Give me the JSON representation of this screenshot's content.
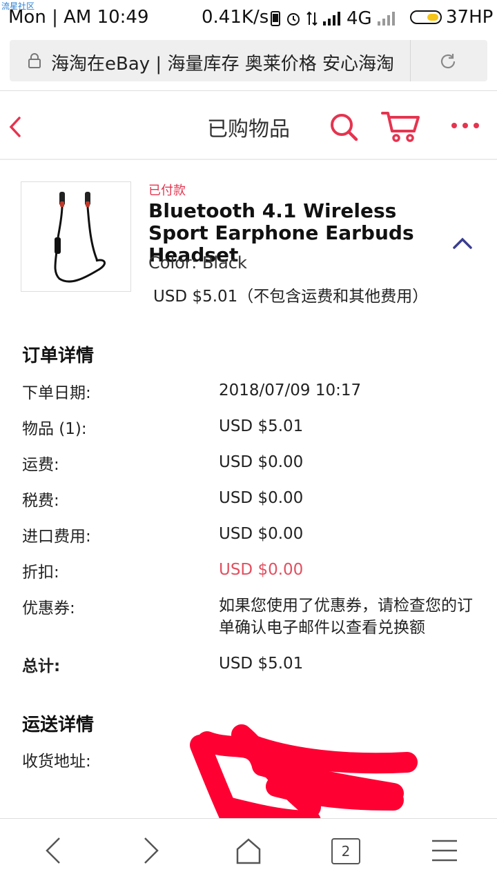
{
  "watermark": "流星社区",
  "status_bar": {
    "time": "Mon | AM  10:49",
    "net_speed": "0.41K/s",
    "network": "4G",
    "battery": "37HP"
  },
  "browser": {
    "url_text": "海淘在eBay | 海量库存 奥莱价格 安心海淘",
    "tab_count": "2"
  },
  "header": {
    "title": "已购物品"
  },
  "item": {
    "status": "已付款",
    "title": "Bluetooth 4.1 Wireless Sport Earphone Earbuds Headset",
    "color": "Color: Black",
    "price": "USD $5.01（不包含运费和其他费用）"
  },
  "order_details": {
    "heading": "订单详情",
    "rows": [
      {
        "label": "下单日期:",
        "value": "2018/07/09 10:17"
      },
      {
        "label": "物品 (1):",
        "value": "USD $5.01"
      },
      {
        "label": "运费:",
        "value": "USD $0.00"
      },
      {
        "label": "税费:",
        "value": "USD $0.00"
      },
      {
        "label": "进口费用:",
        "value": "USD $0.00"
      },
      {
        "label": "折扣:",
        "value": "USD $0.00"
      },
      {
        "label": "优惠券:",
        "value": "如果您使用了优惠券，请检查您的订单确认电子邮件以查看兑换额"
      },
      {
        "label": "总计:",
        "value": "USD $5.01"
      }
    ]
  },
  "shipping_details": {
    "heading": "运送详情",
    "address_label": "收货地址:"
  },
  "colors": {
    "accent_red": "#e5344f",
    "discount_red": "#e25060",
    "chevron_blue": "#3a3d8f"
  }
}
